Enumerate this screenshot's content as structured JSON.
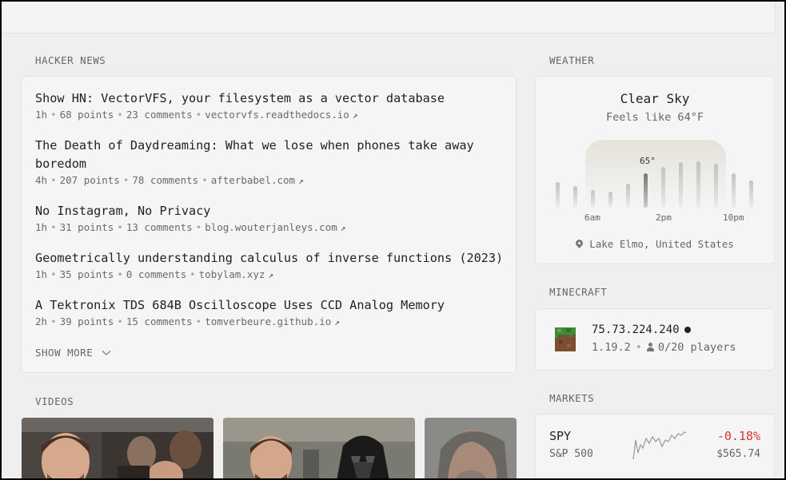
{
  "hacker_news": {
    "title": "HACKER NEWS",
    "items": [
      {
        "title": "Show HN: VectorVFS, your filesystem as a vector database",
        "age": "1h",
        "points": "68 points",
        "comments": "23 comments",
        "domain": "vectorvfs.readthedocs.io"
      },
      {
        "title": "The Death of Daydreaming: What we lose when phones take away boredom",
        "age": "4h",
        "points": "207 points",
        "comments": "78 comments",
        "domain": "afterbabel.com"
      },
      {
        "title": "No Instagram, No Privacy",
        "age": "1h",
        "points": "31 points",
        "comments": "13 comments",
        "domain": "blog.wouterjanleys.com"
      },
      {
        "title": "Geometrically understanding calculus of inverse functions (2023)",
        "age": "1h",
        "points": "35 points",
        "comments": "0 comments",
        "domain": "tobylam.xyz"
      },
      {
        "title": "A Tektronix TDS 684B Oscilloscope Uses CCD Analog Memory",
        "age": "2h",
        "points": "39 points",
        "comments": "15 comments",
        "domain": "tomverbeure.github.io"
      }
    ],
    "show_more": "SHOW MORE",
    "link_icon": "external-link-arrow-icon"
  },
  "videos": {
    "title": "VIDEOS"
  },
  "weather": {
    "title": "WEATHER",
    "condition": "Clear Sky",
    "feels_like": "Feels like 64°F",
    "current_temp": "65°",
    "hours": [
      "6am",
      "2pm",
      "10pm"
    ],
    "location": "Lake Elmo, United States",
    "location_icon": "map-pin-icon"
  },
  "minecraft": {
    "title": "MINECRAFT",
    "host": "75.73.224.240",
    "version": "1.19.2",
    "players": "0/20 players",
    "status_color": "#222222"
  },
  "markets": {
    "title": "MARKETS",
    "symbol": "SPY",
    "name": "S&P 500",
    "change": "-0.18%",
    "price": "$565.74",
    "change_color": "#dd3333"
  }
}
